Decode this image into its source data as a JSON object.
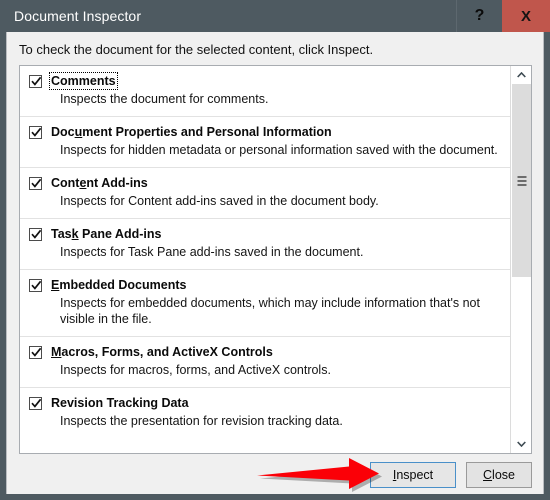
{
  "window": {
    "title": "Document Inspector",
    "help_label": "?",
    "close_label": "X",
    "titlebar_color": "#4e5a61",
    "close_button_color": "#c0564c"
  },
  "instruction": "To check the document for the selected content, click Inspect.",
  "list": {
    "items": [
      {
        "title_before": "C",
        "title_accel": "",
        "title_after": "omments",
        "title_full": "Comments",
        "description": "Inspects the document for comments.",
        "checked": true,
        "focused": true
      },
      {
        "title_before": "Doc",
        "title_accel": "u",
        "title_after": "ment Properties and Personal Information",
        "title_full": "Document Properties and Personal Information",
        "description": "Inspects for hidden metadata or personal information saved with the document.",
        "checked": true,
        "focused": false
      },
      {
        "title_before": "Cont",
        "title_accel": "e",
        "title_after": "nt Add-ins",
        "title_full": "Content Add-ins",
        "description": "Inspects for Content add-ins saved in the document body.",
        "checked": true,
        "focused": false
      },
      {
        "title_before": "Tas",
        "title_accel": "k",
        "title_after": " Pane Add-ins",
        "title_full": "Task Pane Add-ins",
        "description": "Inspects for Task Pane add-ins saved in the document.",
        "checked": true,
        "focused": false
      },
      {
        "title_before": "",
        "title_accel": "E",
        "title_after": "mbedded Documents",
        "title_full": "Embedded Documents",
        "description": "Inspects for embedded documents, which may include information that's not visible in the file.",
        "checked": true,
        "focused": false
      },
      {
        "title_before": "",
        "title_accel": "M",
        "title_after": "acros, Forms, and ActiveX Controls",
        "title_full": "Macros, Forms, and ActiveX Controls",
        "description": "Inspects for macros, forms, and ActiveX controls.",
        "checked": true,
        "focused": false
      },
      {
        "title_before": "Revision Tracking Data",
        "title_accel": "",
        "title_after": "",
        "title_full": "Revision Tracking Data",
        "description": "Inspects the presentation for revision tracking data.",
        "checked": true,
        "focused": false
      }
    ],
    "scrollbar": {
      "up_arrow": "chevron-up",
      "down_arrow": "chevron-down",
      "thumb_position_percent": 0,
      "thumb_size_percent": 55
    }
  },
  "buttons": {
    "inspect": {
      "before": "",
      "accel": "I",
      "after": "nspect",
      "full": "Inspect",
      "focused": true
    },
    "close": {
      "before": "",
      "accel": "C",
      "after": "lose",
      "full": "Close",
      "focused": false
    }
  },
  "annotation": {
    "arrow_color": "#fb0007",
    "points_to": "Inspect"
  }
}
